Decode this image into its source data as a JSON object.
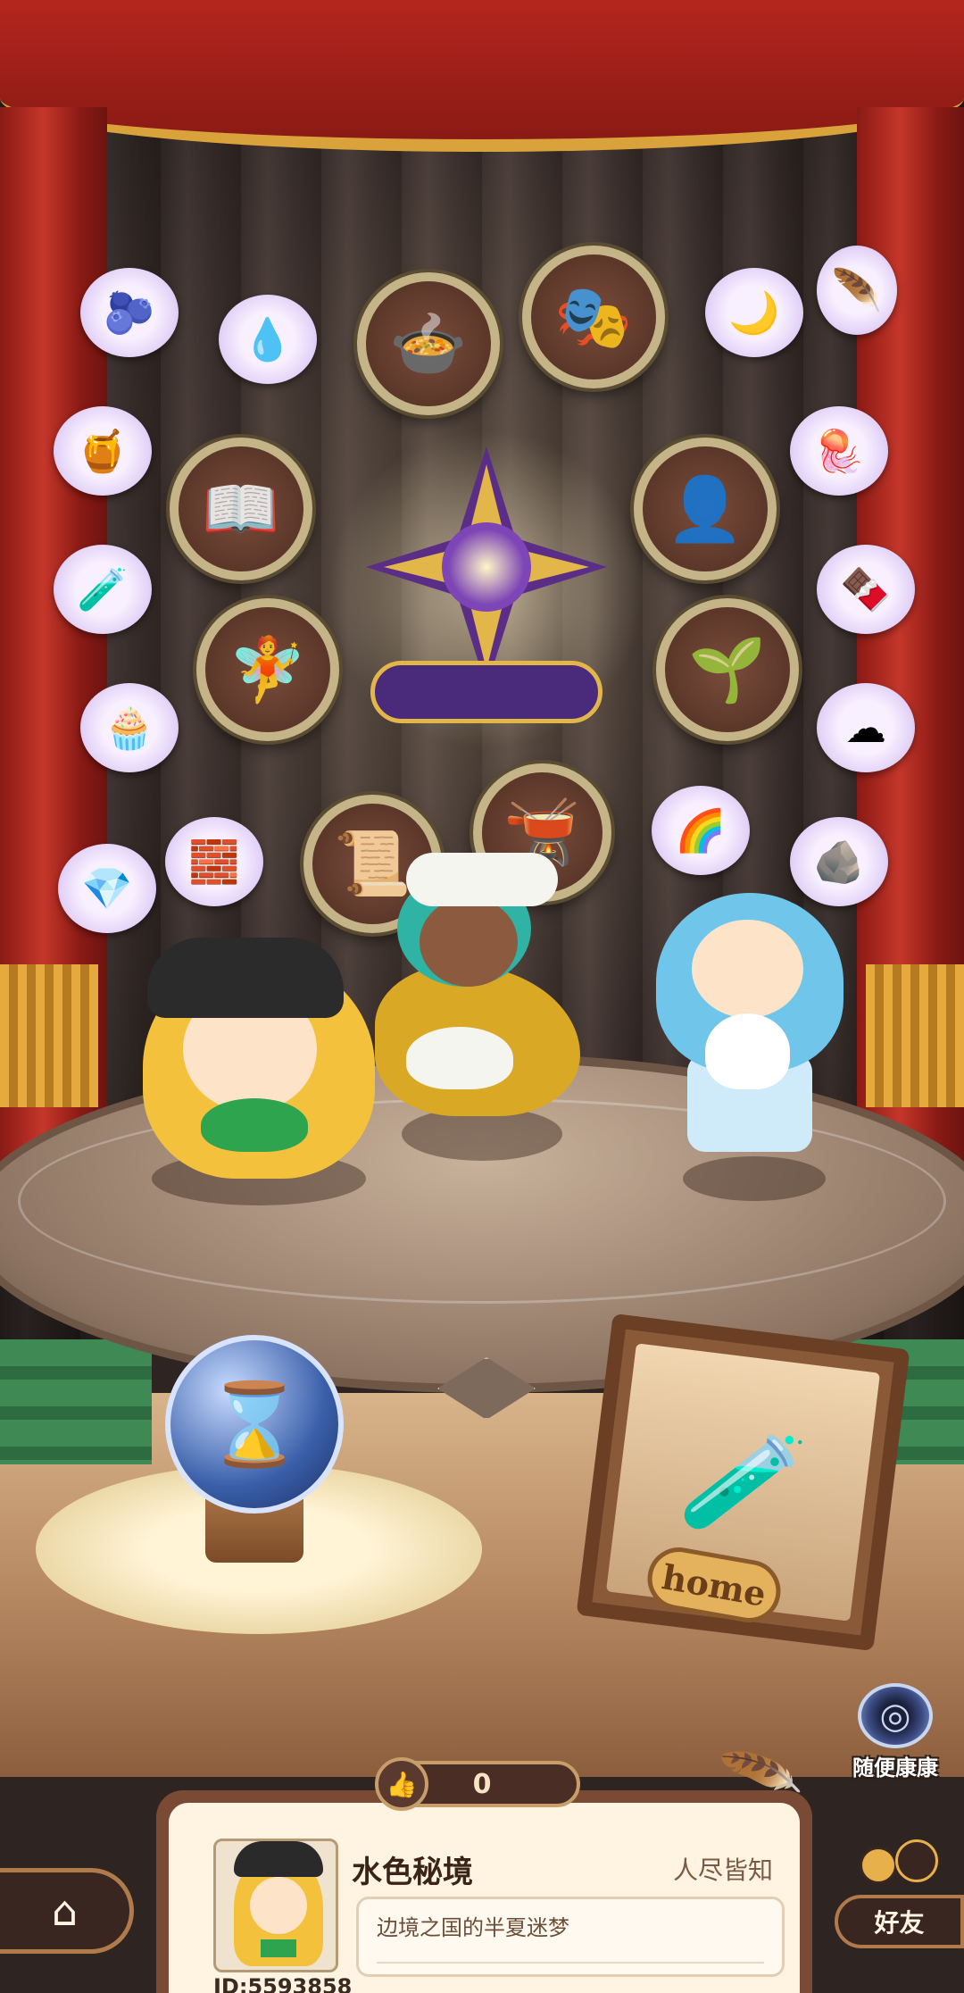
{
  "scene": {
    "badges": [
      {
        "name": "cauldron-badge",
        "icon": "🍲"
      },
      {
        "name": "mask-badge",
        "icon": "🎭"
      },
      {
        "name": "book-badge",
        "icon": "📖"
      },
      {
        "name": "silhouette-badge",
        "icon": "👤"
      },
      {
        "name": "fairy-badge",
        "icon": "🧚"
      },
      {
        "name": "sprout-badge",
        "icon": "🌱"
      },
      {
        "name": "scroll-badge",
        "icon": "📜"
      },
      {
        "name": "pot-badge",
        "icon": "🫕"
      }
    ],
    "items": [
      {
        "name": "blue-cloud-item",
        "icon": "🫐"
      },
      {
        "name": "blue-slime-item",
        "icon": "💧"
      },
      {
        "name": "moon-item",
        "icon": "🌙"
      },
      {
        "name": "dark-feather-item",
        "icon": "🪶"
      },
      {
        "name": "honeycomb-item",
        "icon": "🍯"
      },
      {
        "name": "jellyfish-item",
        "icon": "🪼"
      },
      {
        "name": "potion-item",
        "icon": "🧪"
      },
      {
        "name": "chocolate-item",
        "icon": "🍫"
      },
      {
        "name": "muffin-item",
        "icon": "🧁"
      },
      {
        "name": "cotton-item",
        "icon": "☁"
      },
      {
        "name": "crystal-item",
        "icon": "💎"
      },
      {
        "name": "brick-item",
        "icon": "🧱"
      },
      {
        "name": "rainbow-item",
        "icon": "🌈"
      },
      {
        "name": "stone-item",
        "icon": "🪨"
      }
    ]
  },
  "hourglass": {
    "icon": "⌛"
  },
  "home_frame": {
    "label": "home",
    "icon": "🧪"
  },
  "counter": {
    "icon": "👍",
    "value": "0"
  },
  "panel": {
    "user_id": "ID:5593858",
    "world_name": "水色秘境",
    "visibility": "人尽皆知",
    "description": "边境之国的半夏迷梦"
  },
  "buttons": {
    "home_icon": "⌂",
    "random_label": "随便康康",
    "random_icon": "◎",
    "friends_label": "好友"
  },
  "colors": {
    "curtain": "#b3261e",
    "gold": "#d9a23a",
    "panel_bg": "#fff4e2",
    "emblem_purple": "#5a2d86"
  }
}
